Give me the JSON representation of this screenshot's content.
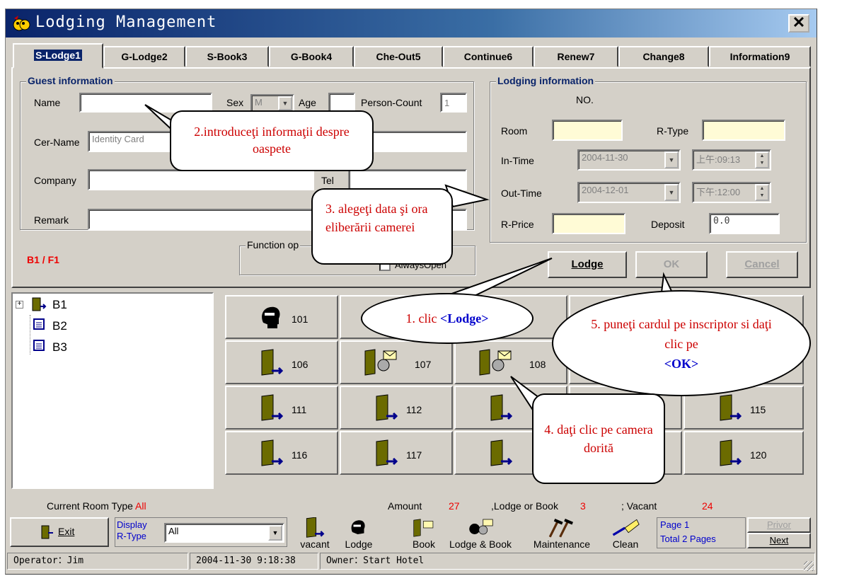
{
  "window": {
    "title": "Lodging Management",
    "close": "✕"
  },
  "tabs": [
    {
      "label": "S-Lodge1"
    },
    {
      "label": "G-Lodge2"
    },
    {
      "label": "S-Book3"
    },
    {
      "label": "G-Book4"
    },
    {
      "label": "Che-Out5"
    },
    {
      "label": "Continue6"
    },
    {
      "label": "Renew7"
    },
    {
      "label": "Change8"
    },
    {
      "label": "Information9"
    }
  ],
  "guest": {
    "title": "Guest information",
    "name_label": "Name",
    "name_value": "",
    "sex_label": "Sex",
    "sex_value": "M",
    "age_label": "Age",
    "age_value": "",
    "person_label": "Person-Count",
    "person_value": "1",
    "cer_label": "Cer-Name",
    "cer_value": "Identity Card",
    "company_label": "Company",
    "company_value": "",
    "tel_label": "Tel",
    "tel_value": "",
    "remark_label": "Remark",
    "remark_value": ""
  },
  "lodging": {
    "title": "Lodging information",
    "no_label": "NO.",
    "room_label": "Room",
    "room_value": "",
    "rtype_label": "R-Type",
    "rtype_value": "",
    "intime_label": "In-Time",
    "intime_date": "2004-11-30",
    "intime_time": "上午:09:13",
    "outtime_label": "Out-Time",
    "outtime_date": "2004-12-01",
    "outtime_time": "下午:12:00",
    "rprice_label": "R-Price",
    "rprice_value": "",
    "deposit_label": "Deposit",
    "deposit_value": "0.0"
  },
  "floor_label": "B1 / F1",
  "function": {
    "title": "Function op",
    "always_open": "AlwaysOpen"
  },
  "buttons": {
    "lodge": "Lodge",
    "ok": "OK",
    "cancel": "Cancel",
    "exit": "Exit",
    "privor": "Privor",
    "next": "Next"
  },
  "tree": {
    "items": [
      {
        "label": "B1"
      },
      {
        "label": "B2"
      },
      {
        "label": "B3"
      }
    ]
  },
  "rooms": [
    {
      "number": "101",
      "status": "lodge"
    },
    {
      "number": "106",
      "status": "vacant"
    },
    {
      "number": "107",
      "status": "lodge-book"
    },
    {
      "number": "108",
      "status": "lodge-book"
    },
    {
      "number": "111",
      "status": "vacant"
    },
    {
      "number": "112",
      "status": "vacant"
    },
    {
      "number": "115",
      "status": "vacant"
    },
    {
      "number": "116",
      "status": "vacant"
    },
    {
      "number": "117",
      "status": "vacant"
    },
    {
      "number": "120",
      "status": "vacant"
    }
  ],
  "summary": {
    "room_type_label": "Current Room Type",
    "room_type_value": "All",
    "amount_label": "Amount",
    "amount_value": "27",
    "lodge_label": ",Lodge or Book",
    "lodge_value": "3",
    "vacant_label": "; Vacant",
    "vacant_value": "24"
  },
  "display": {
    "label1": "Display",
    "label2": "R-Type",
    "value": "All"
  },
  "legend": [
    {
      "label": "vacant"
    },
    {
      "label": "Lodge"
    },
    {
      "label": "Book"
    },
    {
      "label": "Lodge & Book"
    },
    {
      "label": "Maintenance"
    },
    {
      "label": "Clean"
    }
  ],
  "paging": {
    "page": "Page 1",
    "total": "Total 2 Pages"
  },
  "status": {
    "operator": "Operator：Jim",
    "datetime": "2004-11-30 9:18:38",
    "owner": "Owner：Start Hotel"
  },
  "callouts": {
    "c1_text": "1. clic ",
    "c1_bold": "<Lodge>",
    "c2": "2.introduceţi informaţii despre oaspete",
    "c3": "3. alegeţi data şi ora eliberării camerei",
    "c4": "4. daţi clic pe camera dorită",
    "c5_text": "5. puneţi cardul pe inscriptor si daţi clic pe",
    "c5_bold": "<OK>"
  },
  "colors": {
    "title_start": "#0a246a",
    "title_end": "#a6caf0",
    "accent": "#0a246a",
    "highlight": "#fffbd6",
    "red_text": "#e00000"
  }
}
